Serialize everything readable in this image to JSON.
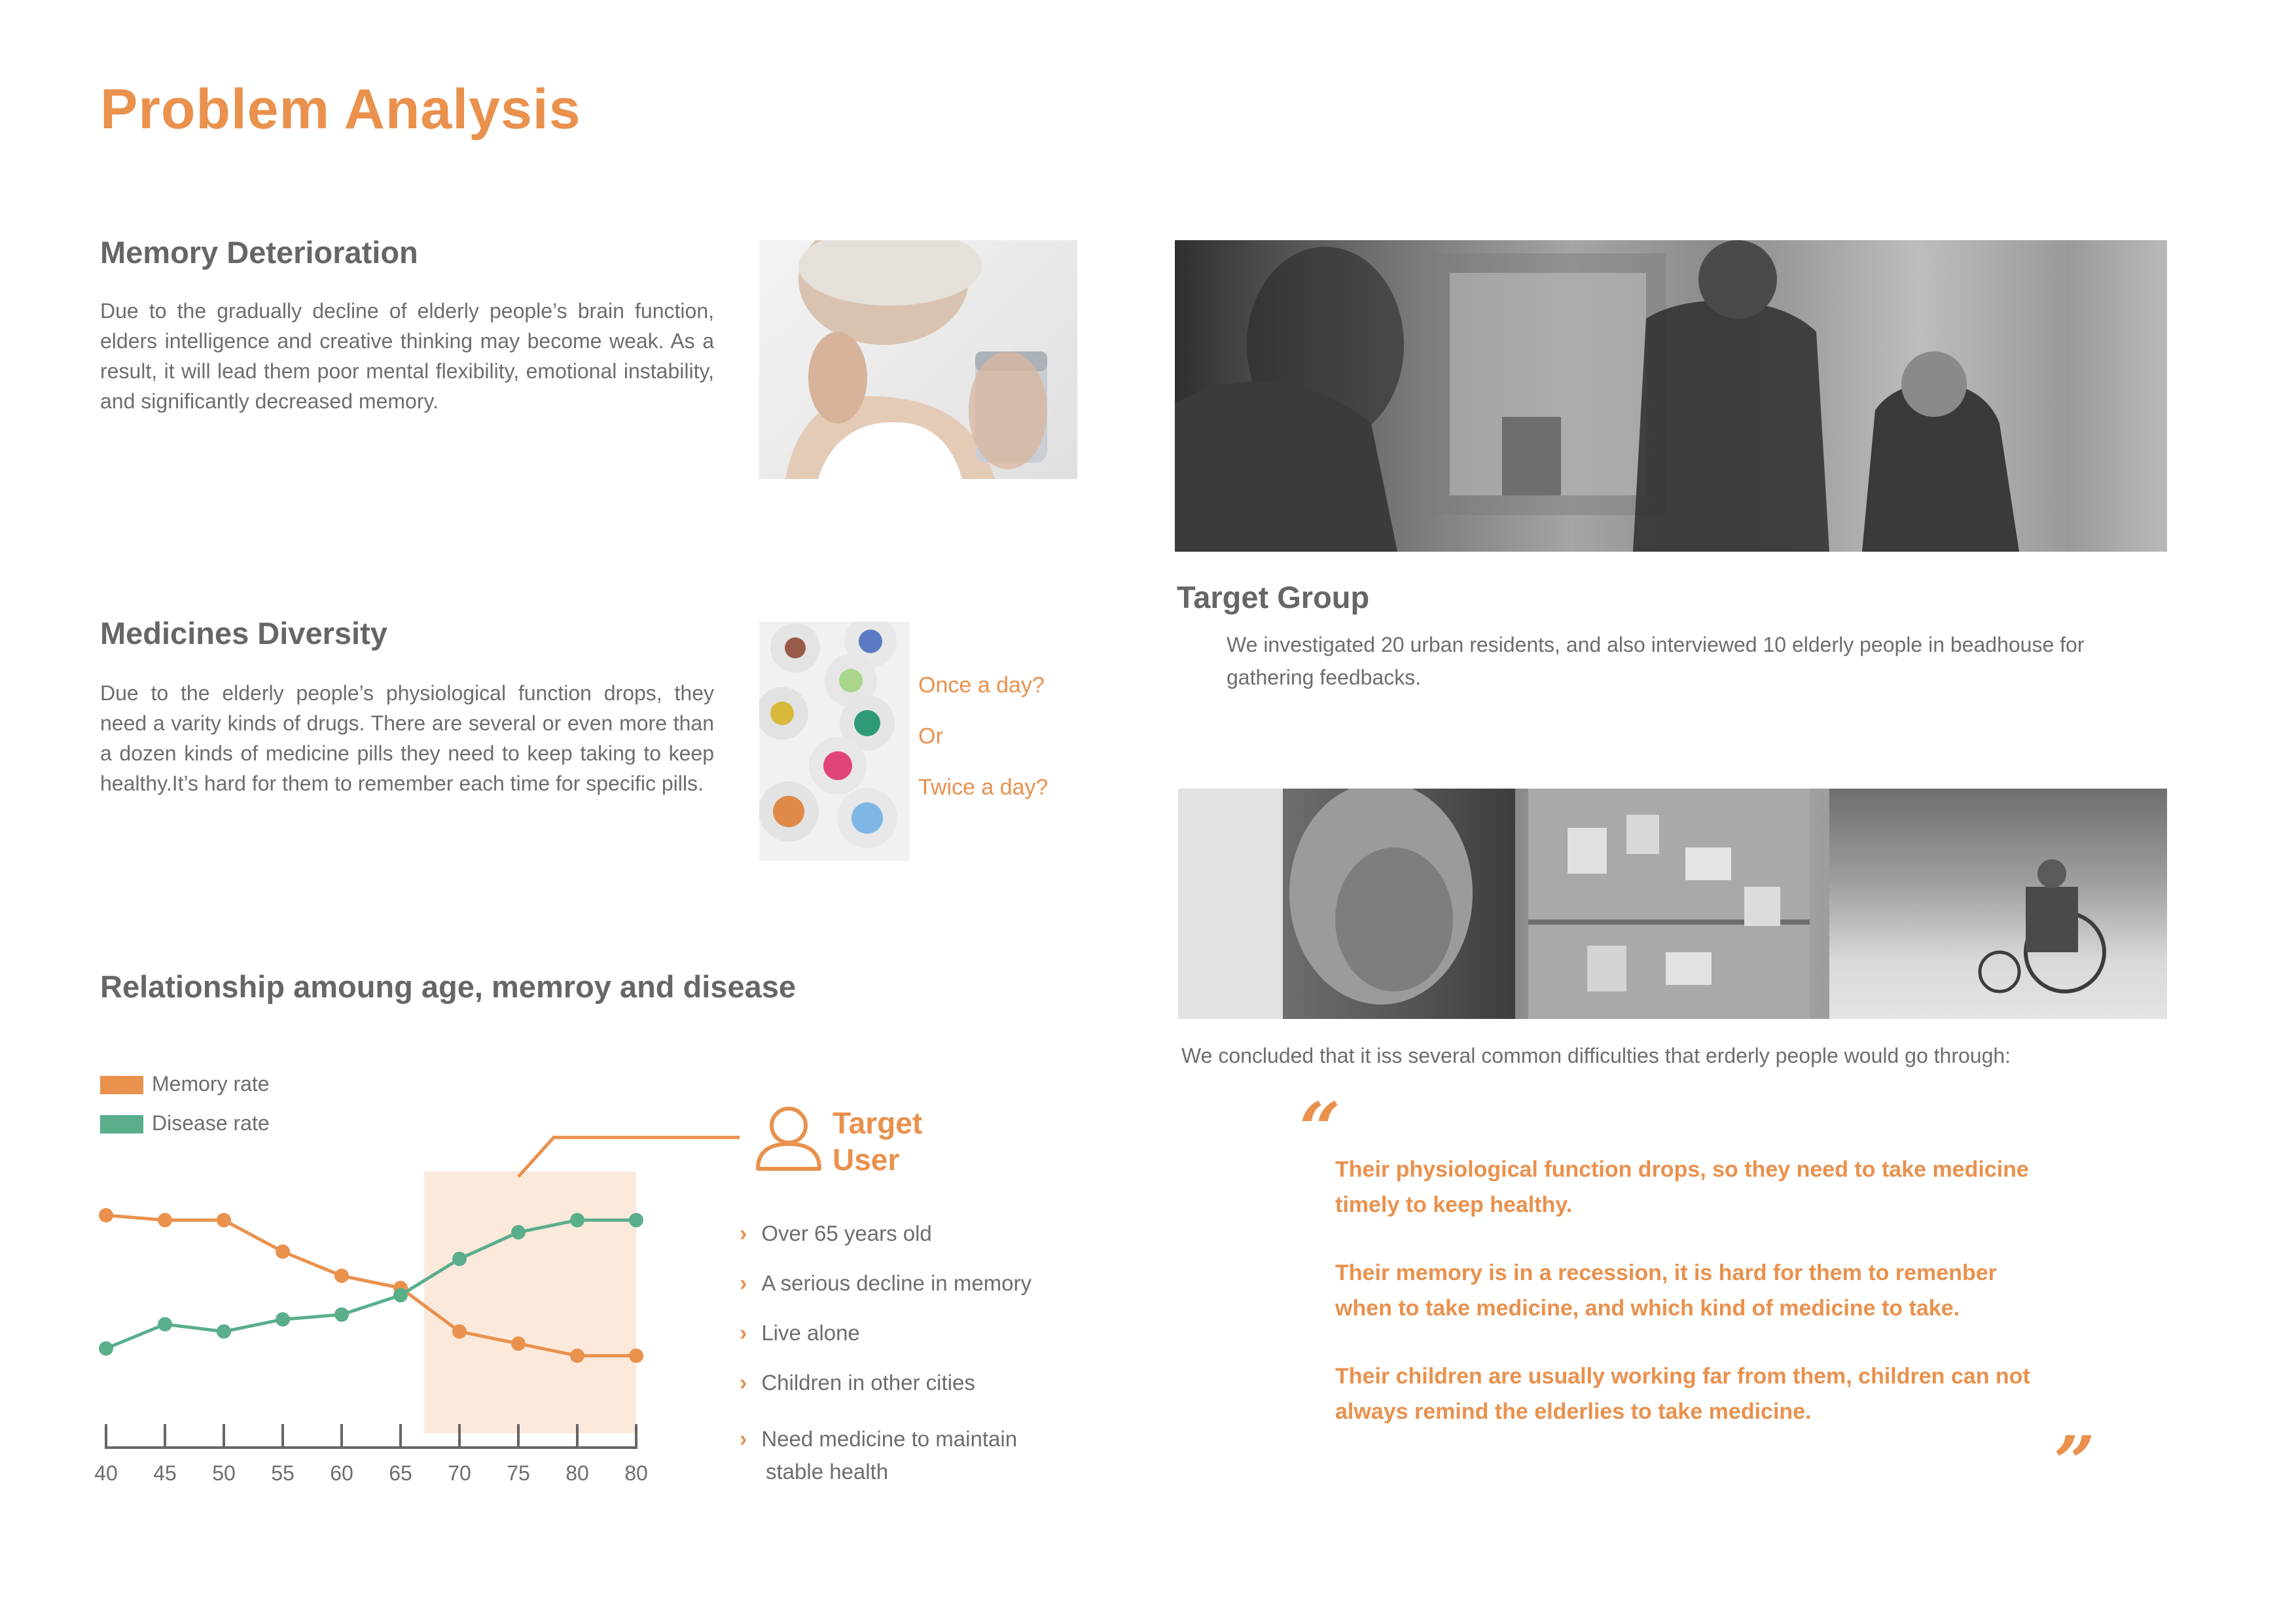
{
  "page_title": "Problem Analysis",
  "memory": {
    "heading": "Memory Deterioration",
    "body": "Due to the gradually decline of elderly people’s brain function, elders intelligence and creative thinking may become weak. As a result, it will lead them poor mental flexibility, emotional instability, and significantly decreased memory."
  },
  "medicines": {
    "heading": "Medicines Diversity",
    "body": "Due to the elderly people’s physiological function drops, they need a varity kinds of drugs. There are several or even more than a dozen kinds of medicine pills they need to keep taking to keep healthy.It’s hard for them to remember each time for specific pills.",
    "questions": [
      "Once a day?",
      "Or",
      "Twice a day?"
    ]
  },
  "chart_section": {
    "heading": "Relationship amoung age, memroy and disease"
  },
  "chart_data": {
    "type": "line",
    "categories": [
      "40",
      "45",
      "50",
      "55",
      "60",
      "65",
      "70",
      "75",
      "80",
      "80"
    ],
    "series": [
      {
        "name": "Memory rate",
        "color": "#e9914d",
        "values": [
          90,
          88,
          88,
          75,
          65,
          60,
          42,
          37,
          32,
          32
        ]
      },
      {
        "name": "Disease rate",
        "color": "#5aae8c",
        "values": [
          35,
          45,
          42,
          47,
          49,
          57,
          72,
          83,
          88,
          88
        ]
      }
    ],
    "highlight_range": [
      "70",
      "80"
    ],
    "title": "",
    "xlabel": "",
    "ylabel": "",
    "ylim": [
      0,
      100
    ],
    "legend": "top-left",
    "grid": false
  },
  "target_user": {
    "title_line1": "Target",
    "title_line2": "User",
    "icon": "user-icon",
    "bullets": [
      "Over 65 years old",
      "A serious decline in memory",
      "Live alone",
      "Children in other cities",
      "Need medicine to maintain"
    ],
    "bullet_continuation": "stable health"
  },
  "target_group": {
    "heading": "Target Group",
    "body": "We investigated 20 urban residents, and also interviewed 10 elderly people in beadhouse for gathering feedbacks."
  },
  "conclusion": {
    "intro": "We concluded that it iss several common difficulties that erderly people would go through:",
    "open_quote": "“",
    "close_quote": "”",
    "points": [
      "Their physiological function drops, so they need to take medicine timely to keep healthy.",
      "Their memory is in a recession, it is hard for them to remenber when to take medicine, and which kind of medicine to take.",
      "Their children are usually working far from them, children can not always remind the elderlies to take medicine."
    ]
  },
  "colors": {
    "accent": "#e9914d",
    "secondary": "#5aae8c",
    "highlight": "#fbe9dc",
    "heading": "#666666",
    "text": "#6d6d6d"
  }
}
